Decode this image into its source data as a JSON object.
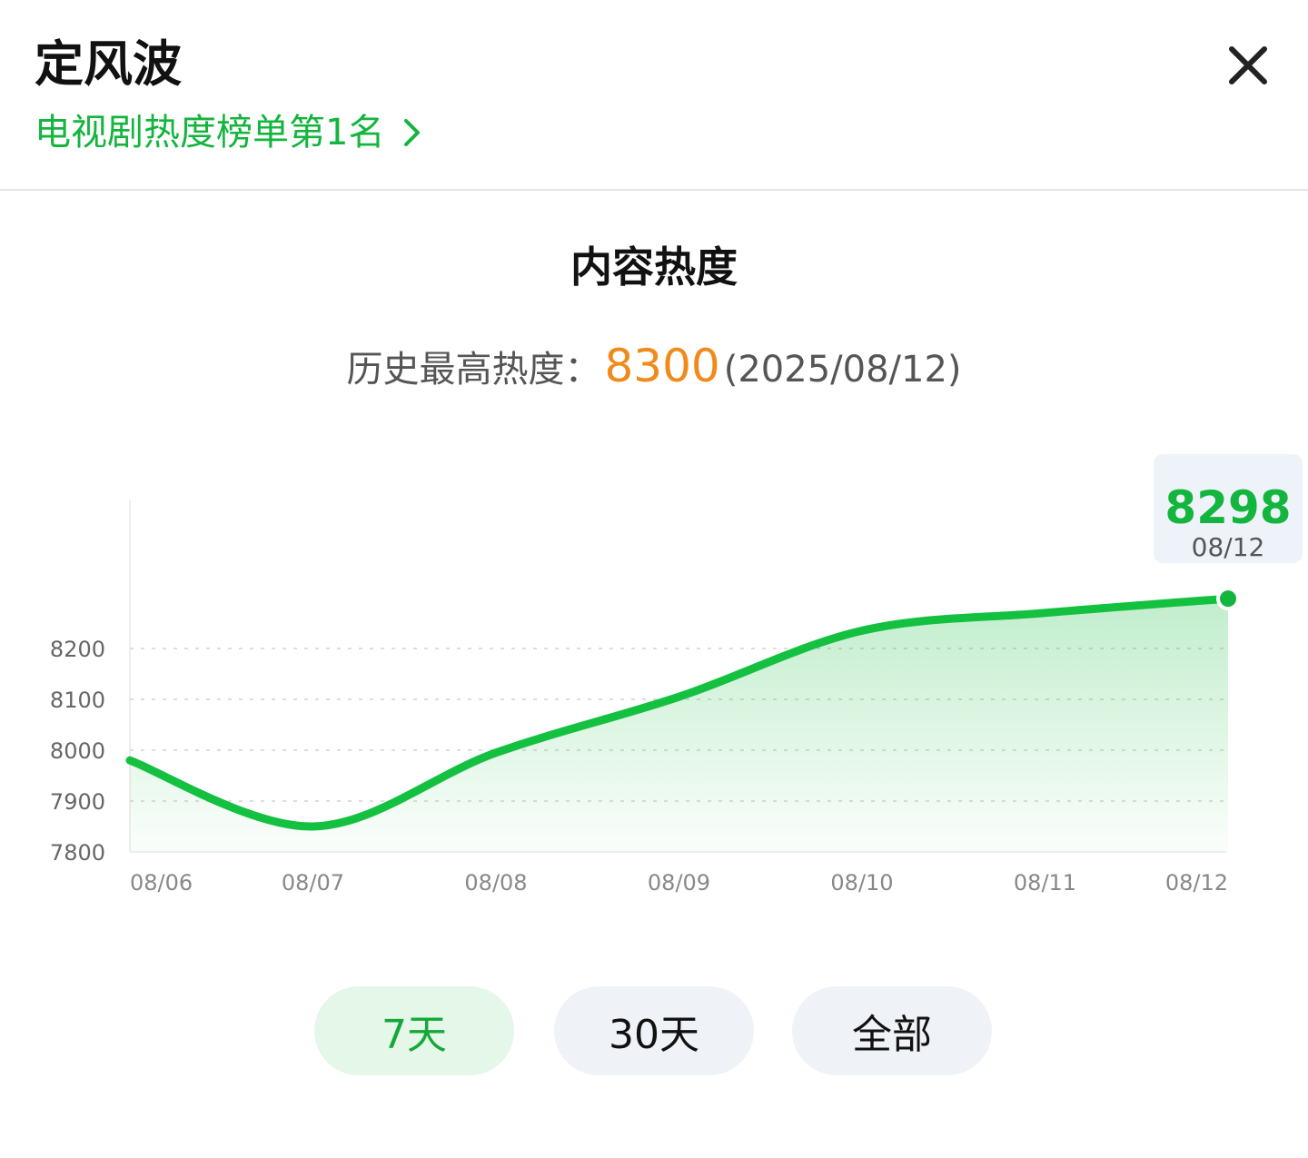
{
  "header": {
    "title": "定风波",
    "rank_text": "电视剧热度榜单第1名"
  },
  "section": {
    "title": "内容热度",
    "peak_label": "历史最高热度：",
    "peak_value": "8300",
    "peak_date": "(2025/08/12)"
  },
  "tooltip": {
    "value": "8298",
    "date": "08/12"
  },
  "tabs": [
    {
      "label": "7天",
      "active": true
    },
    {
      "label": "30天",
      "active": false
    },
    {
      "label": "全部",
      "active": false
    }
  ],
  "colors": {
    "accent": "#14b53e",
    "peak": "#f08a1b",
    "active_tab_bg": "#e4f7e8",
    "tab_bg": "#eff3f8"
  },
  "chart_data": {
    "type": "area",
    "x": [
      "08/06",
      "08/07",
      "08/08",
      "08/09",
      "08/10",
      "08/11",
      "08/12"
    ],
    "series": [
      {
        "values": [
          7980,
          7850,
          7995,
          8105,
          8235,
          8270,
          8298
        ]
      }
    ],
    "yticks": [
      7800,
      7900,
      8000,
      8100,
      8200
    ],
    "ylim": [
      7800,
      8300
    ],
    "grid": true,
    "highlight": {
      "x": "08/12",
      "value": 8298
    }
  }
}
